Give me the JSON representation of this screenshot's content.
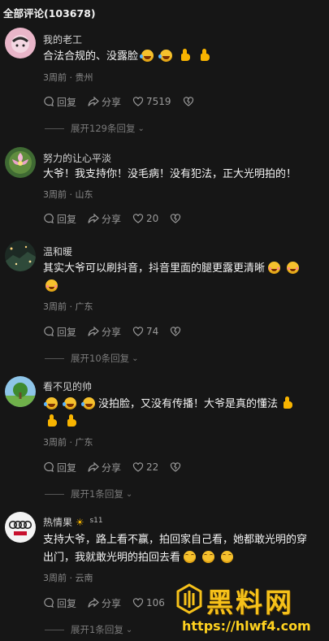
{
  "header": {
    "title": "全部评论(103678)"
  },
  "comments": [
    {
      "username": "我的老工",
      "text": "合法合规的、没露脸",
      "meta": "3周前 · 贵州",
      "reply_label": "回复",
      "share_label": "分享",
      "likes": "7519",
      "expand": "展开129条回复"
    },
    {
      "username": "努力的让心平淡",
      "text": "大爷！我支持你！没毛病！没有犯法，正大光明拍的！",
      "meta": "3周前 · 山东",
      "reply_label": "回复",
      "share_label": "分享",
      "likes": "20"
    },
    {
      "username": "温和暖",
      "text": "其实大爷可以刷抖音，抖音里面的腿更露更清晰",
      "meta": "3周前 · 广东",
      "reply_label": "回复",
      "share_label": "分享",
      "likes": "74",
      "expand": "展开10条回复"
    },
    {
      "username": "看不见的帅",
      "text": "没拍脸，又没有传播！大爷是真的懂法",
      "meta": "3周前 · 广东",
      "reply_label": "回复",
      "share_label": "分享",
      "likes": "22",
      "expand": "展开1条回复"
    },
    {
      "username": "热情果",
      "username_badge_level": "11",
      "text_line1": "支持大爷，路上看不赢，拍回家自己看，她都敢光明的穿",
      "text_line2": "出门，我就敢光明的拍回去看",
      "meta": "3周前 · 云南",
      "reply_label": "回复",
      "share_label": "分享",
      "likes": "106",
      "expand": "展开1条回复"
    }
  ],
  "watermark": {
    "title": "黑料网",
    "url": "https://hlwf4.com"
  },
  "icons": {
    "reply": "comment-bubble-icon",
    "share": "share-arrow-icon",
    "like": "heart-icon",
    "dislike": "broken-heart-icon",
    "expand": "chevron-down-icon"
  },
  "colors": {
    "background": "#161616",
    "accent": "#f6c11a"
  }
}
